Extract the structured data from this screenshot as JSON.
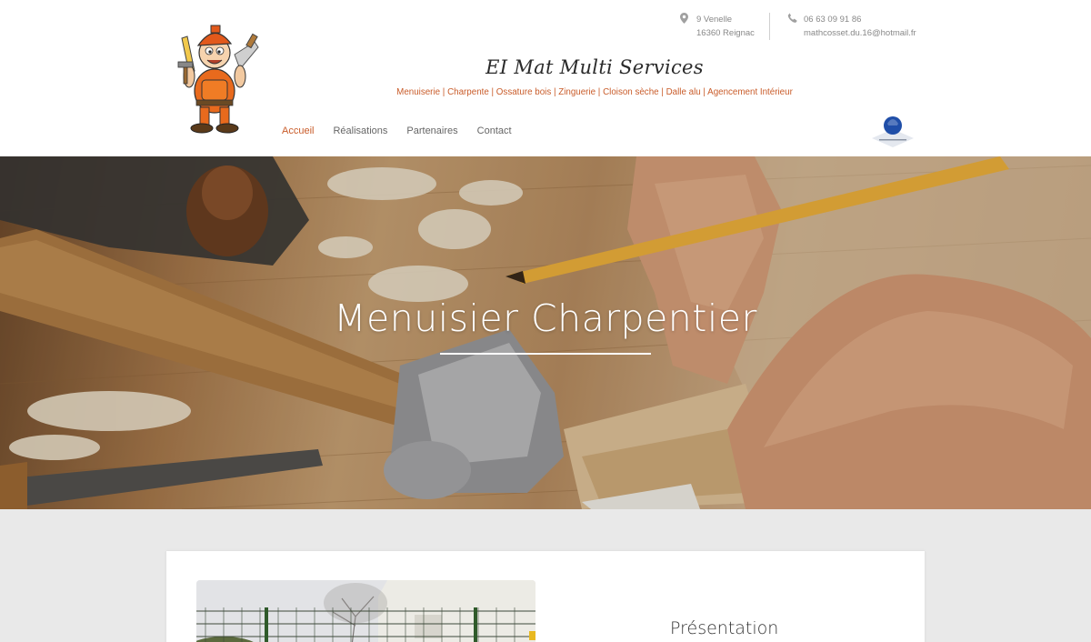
{
  "header": {
    "address_line1": "9 Venelle",
    "address_line2": "16360 Reignac",
    "phone": "06 63 09 91 86",
    "email": "mathcosset.du.16@hotmail.fr",
    "title": "EI Mat Multi Services",
    "tagline": "Menuiserie | Charpente | Ossature bois | Zinguerie | Cloison sèche | Dalle alu | Agencement Intérieur"
  },
  "nav": {
    "items": [
      {
        "label": "Accueil",
        "active": true
      },
      {
        "label": "Réalisations",
        "active": false
      },
      {
        "label": "Partenaires",
        "active": false
      },
      {
        "label": "Contact",
        "active": false
      }
    ]
  },
  "hero": {
    "title": "Menuisier Charpentier"
  },
  "content": {
    "heading": "Présentation"
  },
  "icons": {
    "address": "map-pin-icon",
    "phone": "phone-icon"
  },
  "colors": {
    "accent": "#c95c2a",
    "badge_blue": "#1f4ea8"
  }
}
